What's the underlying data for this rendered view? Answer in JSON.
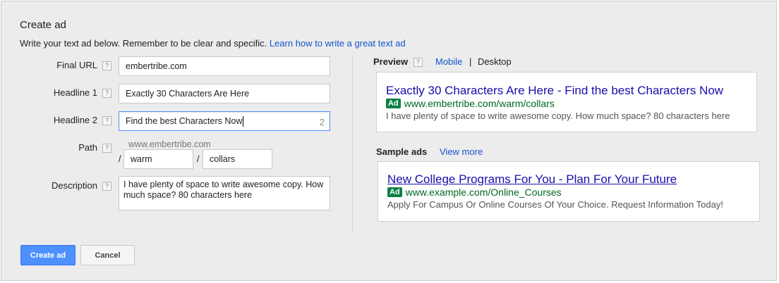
{
  "form": {
    "title": "Create ad",
    "intro": "Write your text ad below. Remember to be clear and specific.",
    "intro_link": "Learn how to write a great text ad",
    "help_glyph": "?",
    "final_url": {
      "label": "Final URL",
      "value": "embertribe.com"
    },
    "headline1": {
      "label": "Headline 1",
      "value": "Exactly 30 Characters Are Here"
    },
    "headline2": {
      "label": "Headline 2",
      "value": "Find the best Characters Now",
      "remaining": "2"
    },
    "path": {
      "label": "Path",
      "domain": "www.embertribe.com",
      "separator": "/",
      "path1": "warm",
      "path2": "collars"
    },
    "description": {
      "label": "Description",
      "value": "I have plenty of space to write awesome copy. How much space? 80 characters here"
    }
  },
  "preview": {
    "heading": "Preview",
    "tabs": {
      "mobile": "Mobile",
      "separator": "|",
      "desktop": "Desktop",
      "active": "Desktop"
    },
    "ad": {
      "title": "Exactly 30 Characters Are Here - Find the best Characters Now",
      "badge": "Ad",
      "url": "www.embertribe.com/warm/collars",
      "description": "I have plenty of space to write awesome copy. How much space? 80 characters here"
    }
  },
  "sample": {
    "heading": "Sample ads",
    "view_more": "View more",
    "ad": {
      "title": "New College Programs For You - Plan For Your Future",
      "badge": "Ad",
      "url": "www.example.com/Online_Courses",
      "description": "Apply For Campus Or Online Courses Of Your Choice. Request Information Today!"
    }
  },
  "actions": {
    "create": "Create ad",
    "cancel": "Cancel"
  },
  "colors": {
    "primary_button": "#4d90fe",
    "link": "#1155cc",
    "ad_title": "#1a0dab",
    "ad_url": "#006621",
    "badge": "#0b8043"
  }
}
